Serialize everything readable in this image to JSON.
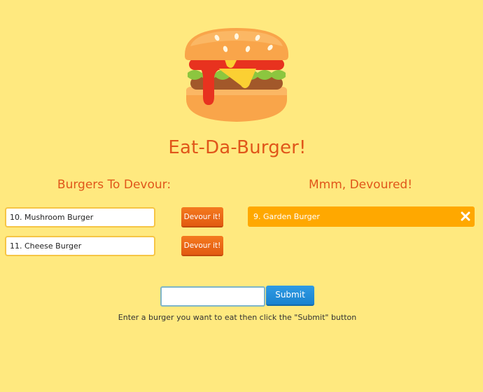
{
  "header": {
    "logo_icon": "burger-icon",
    "title": "Eat-Da-Burger!"
  },
  "to_devour": {
    "heading": "Burgers To Devour:",
    "items": [
      {
        "label": "10. Mushroom Burger",
        "button_label": "Devour it!"
      },
      {
        "label": "11. Cheese Burger",
        "button_label": "Devour it!"
      }
    ]
  },
  "devoured": {
    "heading": "Mmm, Devoured!",
    "items": [
      {
        "label": "9. Garden Burger",
        "delete_icon": "close-icon"
      }
    ]
  },
  "form": {
    "input_value": "",
    "submit_label": "Submit",
    "instructions": "Enter a burger you want to eat then click the \"Submit\" button"
  },
  "colors": {
    "background": "#ffe97f",
    "heading": "#e0561a",
    "devour_button": "#f06d1a",
    "devoured_item": "#ffa800",
    "submit_button": "#238fdb"
  }
}
